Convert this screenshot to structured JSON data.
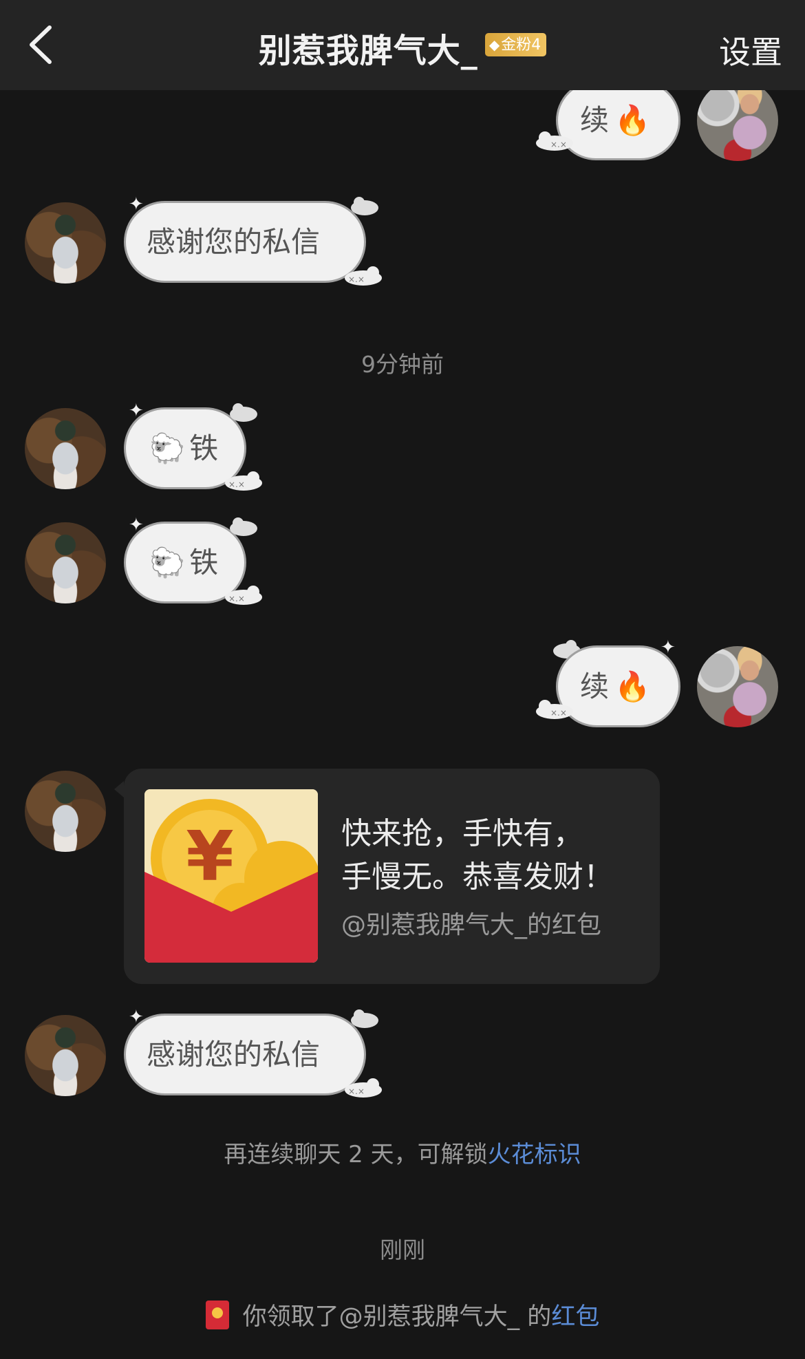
{
  "header": {
    "title": "别惹我脾气大_",
    "badge": "金粉4",
    "settings": "设置"
  },
  "messages": {
    "m1": {
      "text": "续",
      "emoji": "🔥"
    },
    "m2": {
      "text": "感谢您的私信"
    },
    "time1": "9分钟前",
    "m3": {
      "emoji": "🐑",
      "text": "铁"
    },
    "m4": {
      "emoji": "🐑",
      "text": "铁"
    },
    "m5": {
      "text": "续",
      "emoji": "🔥"
    },
    "red_packet": {
      "line1": "快来抢，手快有，",
      "line2": "手慢无。恭喜发财！",
      "from": "@别惹我脾气大_的红包"
    },
    "m6": {
      "text": "感谢您的私信"
    }
  },
  "hint": {
    "prefix": "再连续聊天 2 天，可解锁",
    "link": "火花标识"
  },
  "time2": "刚刚",
  "claim": {
    "prefix": "你领取了@别惹我脾气大_ 的",
    "link": "红包"
  },
  "colors": {
    "background": "#161616",
    "header": "#242424",
    "bubble": "#f1f1f1",
    "link": "#5b8cd6",
    "badge": "#e8b44c"
  }
}
